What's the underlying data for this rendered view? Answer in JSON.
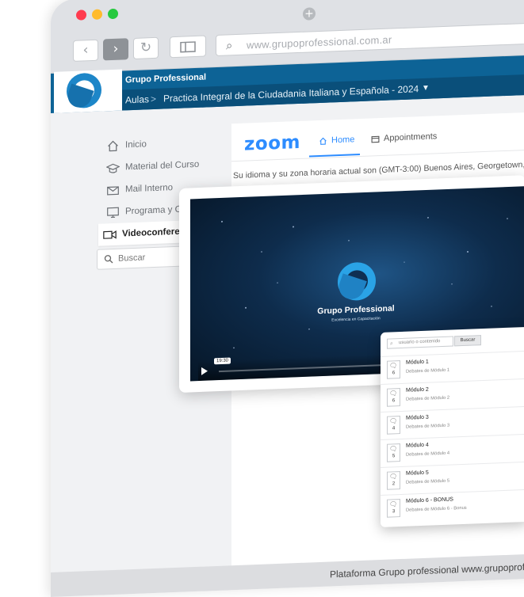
{
  "browser": {
    "url": "www.grupoprofessional.com.ar",
    "tab_plus": "+",
    "nav": {
      "back": "‹",
      "forward": "›",
      "reload": "↻"
    }
  },
  "site": {
    "title": "Grupo Professional",
    "breadcrumb": {
      "root": "Aulas",
      "separator": ">",
      "current": "Practica Integral de la Ciudadania Italiana y Española - 2024",
      "caret": "▼"
    }
  },
  "sidebar": {
    "items": [
      {
        "label": "Inicio",
        "icon": "home-icon"
      },
      {
        "label": "Material del Curso",
        "icon": "graduation-cap-icon"
      },
      {
        "label": "Mail Interno",
        "icon": "mail-icon"
      },
      {
        "label": "Programa y Objetivos",
        "icon": "monitor-icon"
      },
      {
        "label": "Videoconferencias",
        "icon": "video-camera-icon",
        "active": true
      }
    ],
    "search_placeholder": "Buscar"
  },
  "zoom": {
    "logo": "zoom",
    "tabs": [
      {
        "label": "Home",
        "active": true
      },
      {
        "label": "Appointments"
      }
    ],
    "timezone_text": "Su idioma y su zona horaria actual son (GMT-3:00) Buenos Aires, Georgetown, España"
  },
  "video": {
    "brand_title": "Grupo Professional",
    "brand_subtitle": "Excelencia en Capacitación",
    "time_tooltip": "19:30",
    "progress": 0.0
  },
  "forum": {
    "search_placeholder": "usuario o contenido",
    "search_button": "Buscar",
    "modules": [
      {
        "title": "Módulo 1",
        "subtitle": "Debates de Módulo 1",
        "count": "6"
      },
      {
        "title": "Módulo 2",
        "subtitle": "Debates de Módulo 2",
        "count": "6"
      },
      {
        "title": "Módulo 3",
        "subtitle": "Debates de Módulo 3",
        "count": "4"
      },
      {
        "title": "Módulo 4",
        "subtitle": "Debates de Módulo 4",
        "count": "5"
      },
      {
        "title": "Módulo 5",
        "subtitle": "Debates de Módulo 5",
        "count": "2"
      },
      {
        "title": "Módulo 6 - BONUS",
        "subtitle": "Debates de Módulo 6 - Bonus",
        "count": "3"
      }
    ]
  },
  "footer": {
    "text": "Plataforma Grupo professional www.grupoprofessional.com.ar"
  },
  "colors": {
    "brand": "#0d6396",
    "zoom": "#2d8cff",
    "accent": "#1d86c8"
  }
}
